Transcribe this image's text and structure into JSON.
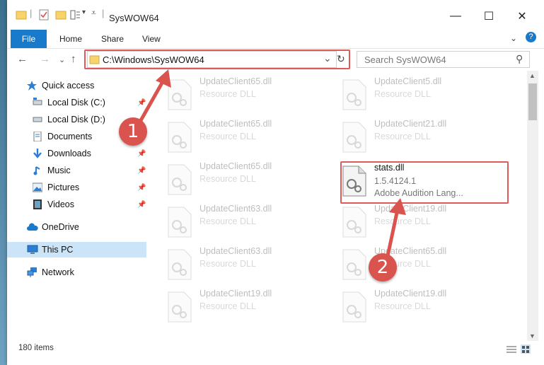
{
  "window": {
    "title": "SysWOW64",
    "controls": {
      "minimize": "—",
      "maximize": "☐",
      "close": "✕"
    }
  },
  "ribbon": {
    "tabs": [
      {
        "label": "File",
        "active": true
      },
      {
        "label": "Home"
      },
      {
        "label": "Share"
      },
      {
        "label": "View"
      }
    ],
    "help_icon": "?"
  },
  "address_bar": {
    "path": "C:\\Windows\\SysWOW64",
    "refresh_icon": "↻",
    "dropdown_icon": "⌄"
  },
  "search": {
    "placeholder": "Search SysWOW64",
    "icon": "⚲"
  },
  "nav_buttons": {
    "back": "←",
    "forward": "→",
    "recent": "⌄",
    "up": "↑"
  },
  "navigation_pane": {
    "items": [
      {
        "label": "Quick access",
        "icon": "star-icon"
      },
      {
        "label": "Local Disk (C:)",
        "icon": "drive-icon",
        "pinned": true
      },
      {
        "label": "Local Disk (D:)",
        "icon": "drive-icon"
      },
      {
        "label": "Documents",
        "icon": "document-icon",
        "pinned": true
      },
      {
        "label": "Downloads",
        "icon": "download-icon",
        "pinned": true
      },
      {
        "label": "Music",
        "icon": "music-icon",
        "pinned": true
      },
      {
        "label": "Pictures",
        "icon": "pictures-icon",
        "pinned": true
      },
      {
        "label": "Videos",
        "icon": "video-icon",
        "pinned": true
      },
      {
        "label": "OneDrive",
        "icon": "cloud-icon"
      },
      {
        "label": "This PC",
        "icon": "computer-icon",
        "selected": true
      },
      {
        "label": "Network",
        "icon": "network-icon"
      }
    ]
  },
  "files": [
    {
      "name": "UpdateClient65.dll",
      "type": "Resource DLL"
    },
    {
      "name": "UpdateClient5.dll",
      "type": "Resource DLL"
    },
    {
      "name": "UpdateClient65.dll",
      "type": "Resource DLL"
    },
    {
      "name": "UpdateClient21.dll",
      "type": "Resource DLL"
    },
    {
      "name": "UpdateClient65.dll",
      "type": "Resource DLL"
    },
    {
      "name": "stats.dll",
      "version": "1.5.4124.1",
      "type": "Adobe Audition Lang...",
      "highlighted": true
    },
    {
      "name": "UpdateClient63.dll",
      "type": "Resource DLL"
    },
    {
      "name": "UpdateClient19.dll",
      "type": "Resource DLL"
    },
    {
      "name": "UpdateClient63.dll",
      "type": "Resource DLL"
    },
    {
      "name": "UpdateClient65.dll",
      "type": "Resource DLL"
    },
    {
      "name": "UpdateClient19.dll",
      "type": "Resource DLL"
    },
    {
      "name": "UpdateClient19.dll",
      "type": "Resource DLL"
    }
  ],
  "status_bar": {
    "item_count": "180 items"
  },
  "annotations": {
    "step1": "1",
    "step2": "2",
    "color": "#d9534f"
  }
}
